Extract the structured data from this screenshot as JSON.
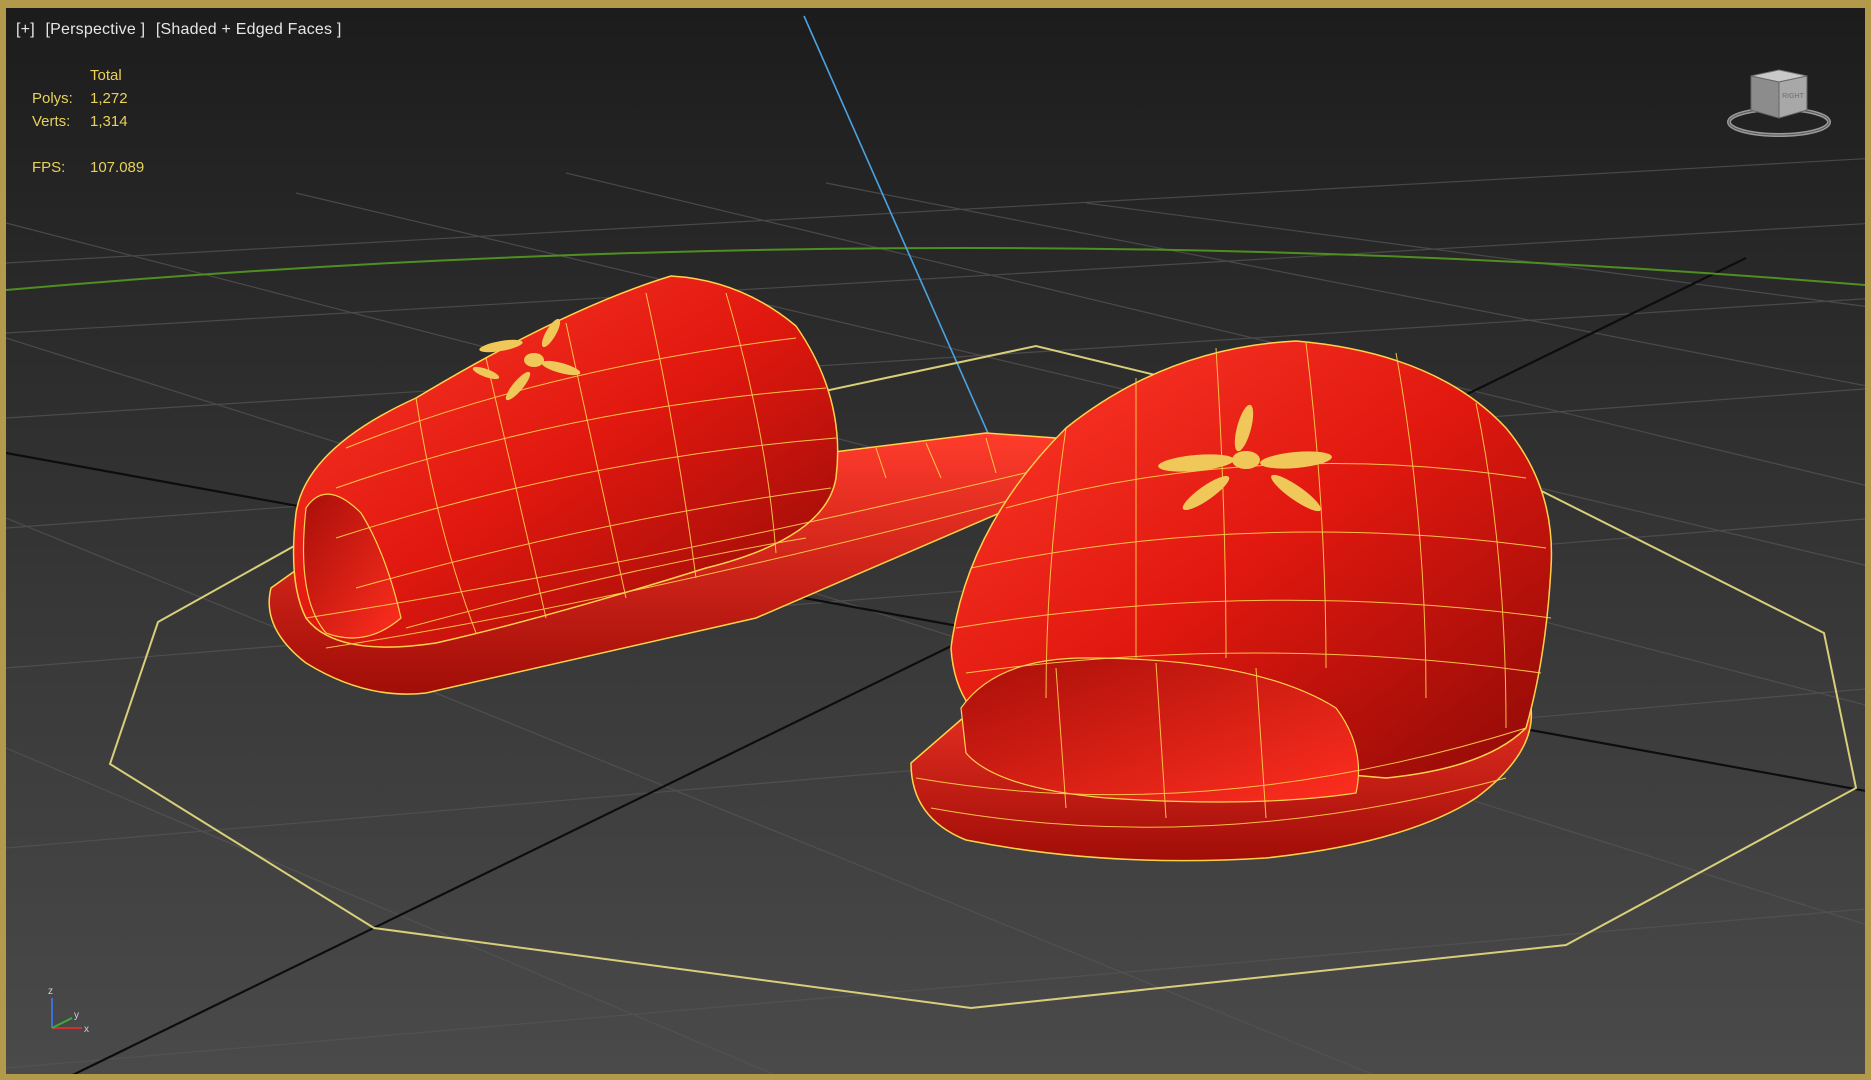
{
  "viewport": {
    "label_parts": [
      "[+]",
      "[Perspective ]",
      "[Shaded + Edged Faces ]"
    ],
    "view_name": "Perspective",
    "shading_mode": "Shaded + Edged Faces"
  },
  "stats": {
    "header": "Total",
    "polys_label": "Polys:",
    "polys_value": "1,272",
    "verts_label": "Verts:",
    "verts_value": "1,314",
    "fps_label": "FPS:",
    "fps_value": "107.089"
  },
  "viewcube": {
    "face_text": "RIGHT"
  },
  "axis_tripod": {
    "z": "z",
    "y": "y",
    "x": "x"
  },
  "colors": {
    "frame": "#b39a4a",
    "stats_text": "#e8d15a",
    "slipper_red": "#e5201c",
    "wireframe": "#ffd24a",
    "grid": "#5a5a5a",
    "grid_major": "#0d0d0d",
    "horizon_green": "#4f8f1f",
    "light_blue_line": "#4aa3e0",
    "octagon_outline": "#d8cf7a"
  }
}
